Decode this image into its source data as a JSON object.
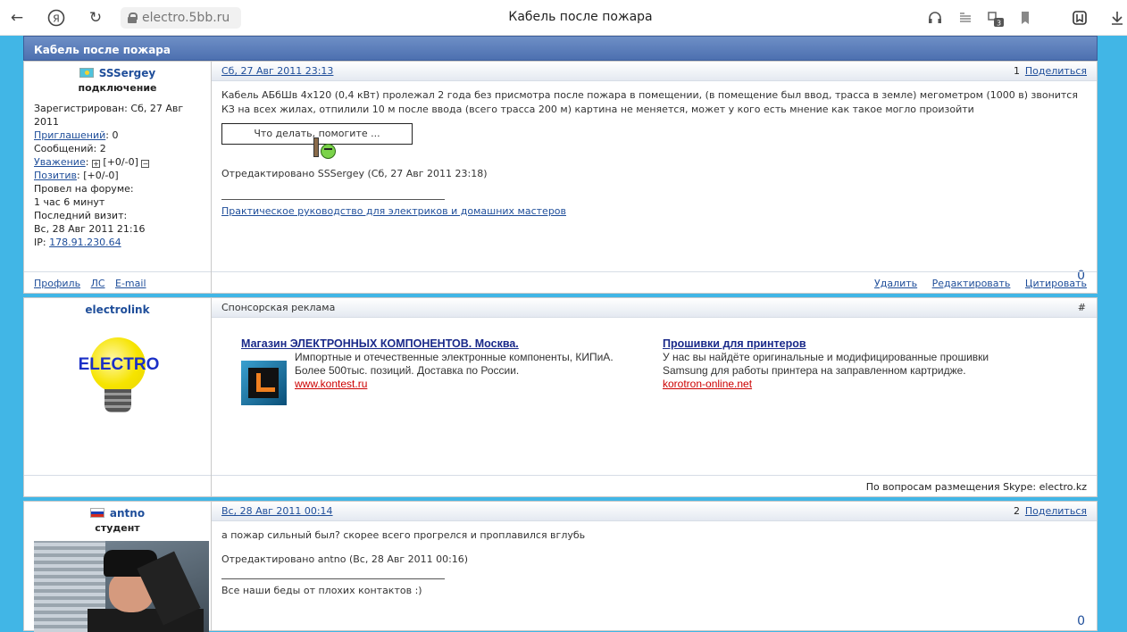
{
  "browser": {
    "url": "electro.5bb.ru",
    "page_title": "Кабель после пожара",
    "badge_count": "3"
  },
  "topic": {
    "title": "Кабель после пожара"
  },
  "posts": [
    {
      "author": "SSSergey",
      "rank": "подключение",
      "reg_label": "Зарегистрирован:",
      "reg_date": "Сб, 27 Авг 2011",
      "invites_label": "Приглашений",
      "invites": ": 0",
      "messages": "Сообщений: 2",
      "respect_label": "Уважение",
      "respect_value": "[+0/-0]",
      "positive_label": "Позитив",
      "positive_value": ": [+0/-0]",
      "time_on_forum_label": "Провел на форуме:",
      "time_on_forum": "1 час 6 минут",
      "last_visit_label": "Последний визит:",
      "last_visit": "Вс, 28 Авг 2011 21:16",
      "ip_label": "IP:",
      "ip": "178.91.230.64",
      "date": "Сб, 27 Авг 2011 23:13",
      "number": "1",
      "share": "Поделиться",
      "text": "Кабель АБбШв 4х120 (0,4 кВт) пролежал 2 года без присмотра после пожара в помещении, (в помещение был ввод, трасса в земле) мегометром (1000 в) звонится КЗ на всех жилах, отпилили 10 м после ввода (всего трасса 200 м) картина не меняется, может у кого есть мнение как такое могло произойти",
      "sign_text": "Что делать, помогите ...",
      "edited": "Отредактировано SSSergey (Сб, 27 Авг 2011 23:18)",
      "signature_link": "Практическое руководство для электриков и домашних мастеров",
      "rating": "0",
      "links": {
        "profile": "Профиль",
        "pm": "ЛС",
        "email": "E-mail"
      },
      "actions": {
        "delete": "Удалить",
        "edit": "Редактировать",
        "quote": "Цитировать"
      }
    },
    {
      "author": "antno",
      "rank": "студент",
      "date": "Вс, 28 Авг 2011 00:14",
      "number": "2",
      "share": "Поделиться",
      "text": "а пожар сильный был? скорее всего прогрелся и проплавился вглубь",
      "edited": "Отредактировано antno (Вс, 28 Авг 2011 00:16)",
      "signature": "Все наши беды от плохих контактов :)",
      "rating": "0"
    }
  ],
  "ad_block": {
    "author": "electrolink",
    "logo_text": "ELECTRO",
    "header": "Спонсорская реклама",
    "hash": "#",
    "footer": "По вопросам размещения Skype: electro.kz",
    "ads": [
      {
        "title": "Магазин ЭЛЕКТРОННЫХ КОМПОНЕНТОВ. Москва.",
        "line1": "Импортные и отечественные электронные компоненты, КИПиА.",
        "line2": "Более 500тыс. позиций. Доставка по России.",
        "url": "www.kontest.ru"
      },
      {
        "title": "Прошивки для принтеров",
        "line1": "У нас вы найдёте оригинальные и модифицированные прошивки",
        "line2": "Samsung для работы принтера на заправленном картридже.",
        "url": "korotron-online.net"
      }
    ]
  }
}
